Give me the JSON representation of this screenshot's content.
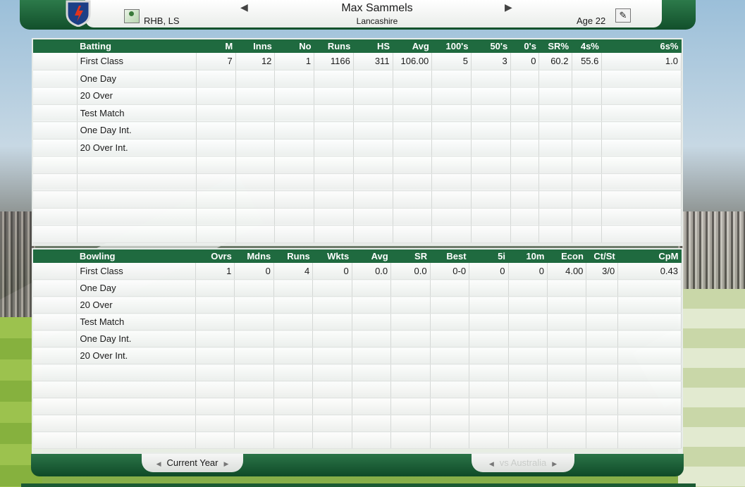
{
  "header": {
    "name": "Max Sammels",
    "team": "Lancashire",
    "hand": "RHB, LS",
    "age": "Age 22",
    "prev_arrow": "◀",
    "next_arrow": "▶"
  },
  "batting": {
    "headers": [
      "Batting",
      "M",
      "Inns",
      "No",
      "Runs",
      "HS",
      "Avg",
      "100's",
      "50's",
      "0's",
      "SR%",
      "4s%",
      "6s%"
    ],
    "rows": [
      [
        "First Class",
        "7",
        "12",
        "1",
        "1166",
        "311",
        "106.00",
        "5",
        "3",
        "0",
        "60.2",
        "55.6",
        "1.0"
      ],
      [
        "One Day",
        "",
        "",
        "",
        "",
        "",
        "",
        "",
        "",
        "",
        "",
        "",
        ""
      ],
      [
        "20 Over",
        "",
        "",
        "",
        "",
        "",
        "",
        "",
        "",
        "",
        "",
        "",
        ""
      ],
      [
        "Test Match",
        "",
        "",
        "",
        "",
        "",
        "",
        "",
        "",
        "",
        "",
        "",
        ""
      ],
      [
        "One Day Int.",
        "",
        "",
        "",
        "",
        "",
        "",
        "",
        "",
        "",
        "",
        "",
        ""
      ],
      [
        "20 Over Int.",
        "",
        "",
        "",
        "",
        "",
        "",
        "",
        "",
        "",
        "",
        "",
        ""
      ]
    ]
  },
  "bowling": {
    "headers": [
      "Bowling",
      "Ovrs",
      "Mdns",
      "Runs",
      "Wkts",
      "Avg",
      "SR",
      "Best",
      "5i",
      "10m",
      "Econ",
      "Ct/St",
      "CpM"
    ],
    "rows": [
      [
        "First Class",
        "1",
        "0",
        "4",
        "0",
        "0.0",
        "0.0",
        "0-0",
        "0",
        "0",
        "4.00",
        "3/0",
        "0.43"
      ],
      [
        "One Day",
        "",
        "",
        "",
        "",
        "",
        "",
        "",
        "",
        "",
        "",
        "",
        ""
      ],
      [
        "20 Over",
        "",
        "",
        "",
        "",
        "",
        "",
        "",
        "",
        "",
        "",
        "",
        ""
      ],
      [
        "Test Match",
        "",
        "",
        "",
        "",
        "",
        "",
        "",
        "",
        "",
        "",
        "",
        ""
      ],
      [
        "One Day Int.",
        "",
        "",
        "",
        "",
        "",
        "",
        "",
        "",
        "",
        "",
        "",
        ""
      ],
      [
        "20 Over Int.",
        "",
        "",
        "",
        "",
        "",
        "",
        "",
        "",
        "",
        "",
        "",
        ""
      ]
    ]
  },
  "footer": {
    "current_year": "Current Year",
    "vs_opponent": "vs Australia",
    "tab_left_arrow": "◀",
    "tab_right_arrow": "▶"
  },
  "colors": {
    "header_green": "#1f6a3f",
    "panel_bg": "#eef1ef"
  }
}
